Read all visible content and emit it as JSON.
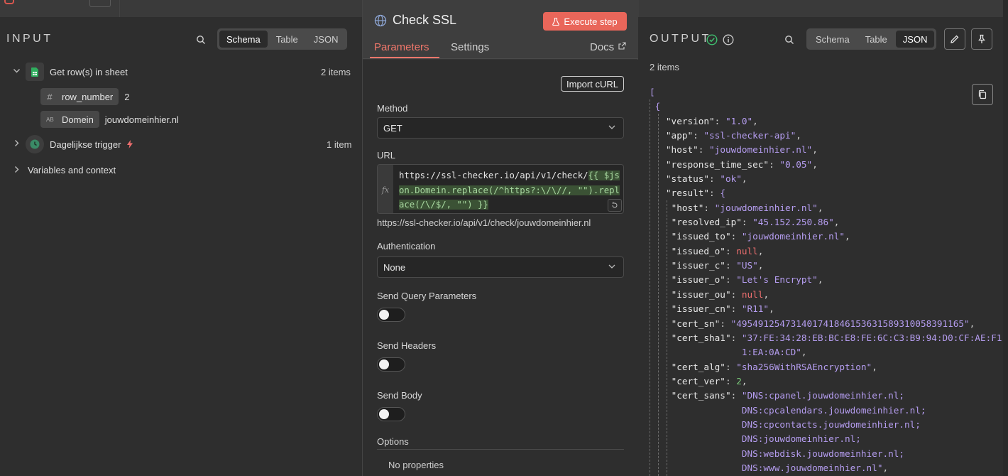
{
  "input": {
    "title": "INPUT",
    "view_tabs": [
      "Schema",
      "Table",
      "JSON"
    ],
    "active_tab": "Schema",
    "tree": {
      "node1": {
        "label": "Get row(s) in sheet",
        "count": "2 items"
      },
      "field1": {
        "type_icon": "#",
        "name": "row_number",
        "value": "2"
      },
      "field2": {
        "type_icon": "AB",
        "name": "Domein",
        "value": "jouwdomeinhier.nl"
      },
      "node2": {
        "label": "Dagelijkse trigger",
        "count": "1 item"
      },
      "node3": {
        "label": "Variables and context"
      }
    }
  },
  "modal": {
    "title": "Check SSL",
    "execute_label": "Execute step",
    "tabs": {
      "parameters": "Parameters",
      "settings": "Settings",
      "docs": "Docs"
    },
    "import_curl": "Import cURL",
    "method_label": "Method",
    "method_value": "GET",
    "url_label": "URL",
    "url_prefix": "https://ssl-checker.io/api/v1/check/",
    "url_expression": "{{ $json.Domein.replace(/^https?:\\/\\//, \"\").replace(/\\/$/, \"\") }}",
    "fx_label": "fx",
    "url_preview": "https://ssl-checker.io/api/v1/check/jouwdomeinhier.nl",
    "auth_label": "Authentication",
    "auth_value": "None",
    "send_query_label": "Send Query Parameters",
    "send_headers_label": "Send Headers",
    "send_body_label": "Send Body",
    "options_label": "Options",
    "no_properties": "No properties"
  },
  "output": {
    "title": "OUTPUT",
    "view_tabs": [
      "Schema",
      "Table",
      "JSON"
    ],
    "active_tab": "JSON",
    "count": "2 items"
  },
  "json_lines": [
    {
      "t": "o",
      "text": "["
    },
    {
      "t": "o",
      "text": " {"
    },
    {
      "t": "kv",
      "key": "\"version\"",
      "val": "\"1.0\"",
      "vt": "s"
    },
    {
      "t": "kv",
      "key": "\"app\"",
      "val": "\"ssl-checker-api\"",
      "vt": "s"
    },
    {
      "t": "kv",
      "key": "\"host\"",
      "val": "\"jouwdomeinhier.nl\"",
      "vt": "s"
    },
    {
      "t": "kv",
      "key": "\"response_time_sec\"",
      "val": "\"0.05\"",
      "vt": "s"
    },
    {
      "t": "kv",
      "key": "\"status\"",
      "val": "\"ok\"",
      "vt": "s"
    },
    {
      "t": "ko",
      "key": "\"result\"",
      "val": "{"
    },
    {
      "t": "kv2",
      "key": "\"host\"",
      "val": "\"jouwdomeinhier.nl\"",
      "vt": "s"
    },
    {
      "t": "kv2",
      "key": "\"resolved_ip\"",
      "val": "\"45.152.250.86\"",
      "vt": "s"
    },
    {
      "t": "kv2",
      "key": "\"issued_to\"",
      "val": "\"jouwdomeinhier.nl\"",
      "vt": "s"
    },
    {
      "t": "kv2",
      "key": "\"issued_o\"",
      "val": "null",
      "vt": "nl"
    },
    {
      "t": "kv2",
      "key": "\"issuer_c\"",
      "val": "\"US\"",
      "vt": "s"
    },
    {
      "t": "kv2",
      "key": "\"issuer_o\"",
      "val": "\"Let's Encrypt\"",
      "vt": "s"
    },
    {
      "t": "kv2",
      "key": "\"issuer_ou\"",
      "val": "null",
      "vt": "nl"
    },
    {
      "t": "kv2",
      "key": "\"issuer_cn\"",
      "val": "\"R11\"",
      "vt": "s"
    },
    {
      "t": "kv2",
      "key": "\"cert_sn\"",
      "val": "\"495491254731401741846153631589310058391165\"",
      "vt": "s"
    },
    {
      "t": "kv2",
      "key": "\"cert_sha1\"",
      "val": "\"37:FE:34:28:EB:BC:E8:FE:6C:C3:B9:94:D0:CF:AE:F1:2",
      "vt": "s",
      "nocomma": true
    },
    {
      "t": "cont",
      "val": "1:EA:0A:CD\"",
      "vt": "s",
      "pad": "             "
    },
    {
      "t": "kv2",
      "key": "\"cert_alg\"",
      "val": "\"sha256WithRSAEncryption\"",
      "vt": "s"
    },
    {
      "t": "kv2",
      "key": "\"cert_ver\"",
      "val": "2",
      "vt": "n"
    },
    {
      "t": "kv2",
      "key": "\"cert_sans\"",
      "val": "\"DNS:cpanel.jouwdomeinhier.nl;",
      "vt": "s",
      "nocomma": true
    },
    {
      "t": "cont",
      "val": "DNS:cpcalendars.jouwdomeinhier.nl;",
      "vt": "s",
      "pad": "             ",
      "nocomma": true
    },
    {
      "t": "cont",
      "val": "DNS:cpcontacts.jouwdomeinhier.nl;",
      "vt": "s",
      "pad": "             ",
      "nocomma": true
    },
    {
      "t": "cont",
      "val": "DNS:jouwdomeinhier.nl;",
      "vt": "s",
      "pad": "             ",
      "nocomma": true
    },
    {
      "t": "cont",
      "val": "DNS:webdisk.jouwdomeinhier.nl;",
      "vt": "s",
      "pad": "             ",
      "nocomma": true
    },
    {
      "t": "cont",
      "val": "DNS:www.jouwdomeinhier.nl\"",
      "vt": "s",
      "pad": "             "
    }
  ],
  "colors": {
    "accent": "#f0776b",
    "execute": "#e9665a",
    "success": "#3fbf6f",
    "string": "#b59df0",
    "null": "#ef6f6f",
    "number": "#7ac97a"
  }
}
